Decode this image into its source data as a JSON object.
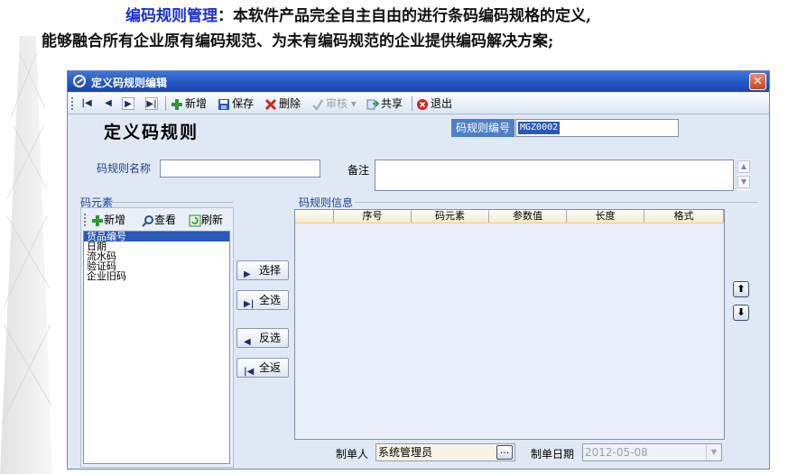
{
  "intro": {
    "highlight": "编码规则管理",
    "line1_rest": "：本软件产品完全自主自由的进行条码编码规格的定义,",
    "line2": "能够融合所有企业原有编码规范、为未有编码规范的企业提供编码解决方案;"
  },
  "window": {
    "title": "定义码规则编辑",
    "close_label": "✕"
  },
  "toolbar": {
    "first_icon": "first-record-icon",
    "prev_icon": "previous-record-icon",
    "next_icon": "next-record-icon",
    "last_icon": "last-record-icon",
    "add_label": "新增",
    "save_label": "保存",
    "delete_label": "删除",
    "review_label": "审核",
    "share_label": "共享",
    "exit_label": "退出"
  },
  "form": {
    "heading": "定义码规则",
    "code_label": "码规则编号",
    "code_value": "MGZ0002",
    "name_label": "码规则名称",
    "name_value": "",
    "remark_label": "备注",
    "remark_value": ""
  },
  "elements_panel": {
    "title": "码元素",
    "add_label": "新增",
    "view_label": "查看",
    "refresh_label": "刷新",
    "items": [
      "货品编号",
      "日期",
      "流水码",
      "验证码",
      "企业旧码"
    ],
    "selected_index": 0
  },
  "move_buttons": {
    "select_label": "选择",
    "select_all_label": "全选",
    "deselect_label": "反选",
    "return_all_label": "全返"
  },
  "rule_info": {
    "title": "码规则信息",
    "columns": [
      "",
      "序号",
      "码元素",
      "参数值",
      "长度",
      "格式"
    ],
    "rows": []
  },
  "footer": {
    "maker_label": "制单人",
    "maker_value": "系统管理员",
    "ellipsis_label": "...",
    "date_label": "制单日期",
    "date_value": "2012-05-08"
  },
  "colors": {
    "highlight": "#1a2fd6",
    "title_bar": "#2456c4",
    "selection": "#2b59b9"
  }
}
